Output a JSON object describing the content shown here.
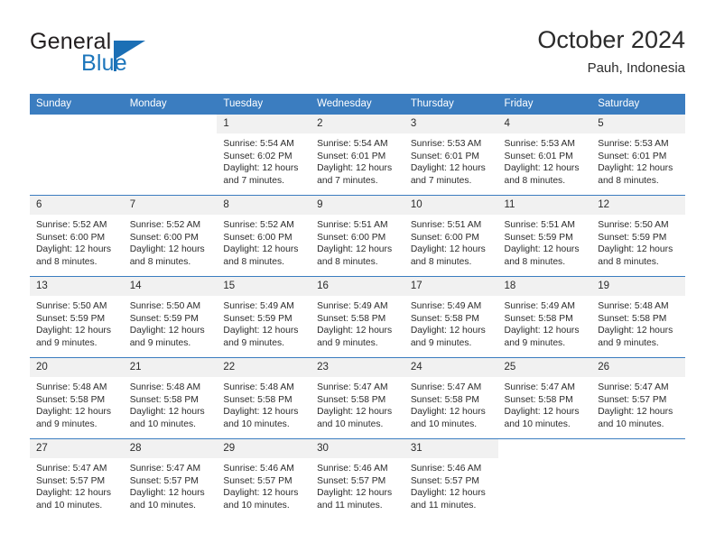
{
  "brand": {
    "word1": "General",
    "word2": "Blue",
    "flag_icon": "triangle-flag-icon"
  },
  "header": {
    "month_title": "October 2024",
    "location": "Pauh, Indonesia"
  },
  "colors": {
    "header_blue": "#3b7dc0",
    "brand_blue": "#1b75bb",
    "daynum_bg": "#f1f1f1",
    "text": "#2b2b2b"
  },
  "calendar": {
    "weekday_headers": [
      "Sunday",
      "Monday",
      "Tuesday",
      "Wednesday",
      "Thursday",
      "Friday",
      "Saturday"
    ],
    "weeks": [
      [
        {
          "empty": true
        },
        {
          "empty": true
        },
        {
          "day": "1",
          "sunrise": "Sunrise: 5:54 AM",
          "sunset": "Sunset: 6:02 PM",
          "daylight1": "Daylight: 12 hours",
          "daylight2": "and 7 minutes."
        },
        {
          "day": "2",
          "sunrise": "Sunrise: 5:54 AM",
          "sunset": "Sunset: 6:01 PM",
          "daylight1": "Daylight: 12 hours",
          "daylight2": "and 7 minutes."
        },
        {
          "day": "3",
          "sunrise": "Sunrise: 5:53 AM",
          "sunset": "Sunset: 6:01 PM",
          "daylight1": "Daylight: 12 hours",
          "daylight2": "and 7 minutes."
        },
        {
          "day": "4",
          "sunrise": "Sunrise: 5:53 AM",
          "sunset": "Sunset: 6:01 PM",
          "daylight1": "Daylight: 12 hours",
          "daylight2": "and 8 minutes."
        },
        {
          "day": "5",
          "sunrise": "Sunrise: 5:53 AM",
          "sunset": "Sunset: 6:01 PM",
          "daylight1": "Daylight: 12 hours",
          "daylight2": "and 8 minutes."
        }
      ],
      [
        {
          "day": "6",
          "sunrise": "Sunrise: 5:52 AM",
          "sunset": "Sunset: 6:00 PM",
          "daylight1": "Daylight: 12 hours",
          "daylight2": "and 8 minutes."
        },
        {
          "day": "7",
          "sunrise": "Sunrise: 5:52 AM",
          "sunset": "Sunset: 6:00 PM",
          "daylight1": "Daylight: 12 hours",
          "daylight2": "and 8 minutes."
        },
        {
          "day": "8",
          "sunrise": "Sunrise: 5:52 AM",
          "sunset": "Sunset: 6:00 PM",
          "daylight1": "Daylight: 12 hours",
          "daylight2": "and 8 minutes."
        },
        {
          "day": "9",
          "sunrise": "Sunrise: 5:51 AM",
          "sunset": "Sunset: 6:00 PM",
          "daylight1": "Daylight: 12 hours",
          "daylight2": "and 8 minutes."
        },
        {
          "day": "10",
          "sunrise": "Sunrise: 5:51 AM",
          "sunset": "Sunset: 6:00 PM",
          "daylight1": "Daylight: 12 hours",
          "daylight2": "and 8 minutes."
        },
        {
          "day": "11",
          "sunrise": "Sunrise: 5:51 AM",
          "sunset": "Sunset: 5:59 PM",
          "daylight1": "Daylight: 12 hours",
          "daylight2": "and 8 minutes."
        },
        {
          "day": "12",
          "sunrise": "Sunrise: 5:50 AM",
          "sunset": "Sunset: 5:59 PM",
          "daylight1": "Daylight: 12 hours",
          "daylight2": "and 8 minutes."
        }
      ],
      [
        {
          "day": "13",
          "sunrise": "Sunrise: 5:50 AM",
          "sunset": "Sunset: 5:59 PM",
          "daylight1": "Daylight: 12 hours",
          "daylight2": "and 9 minutes."
        },
        {
          "day": "14",
          "sunrise": "Sunrise: 5:50 AM",
          "sunset": "Sunset: 5:59 PM",
          "daylight1": "Daylight: 12 hours",
          "daylight2": "and 9 minutes."
        },
        {
          "day": "15",
          "sunrise": "Sunrise: 5:49 AM",
          "sunset": "Sunset: 5:59 PM",
          "daylight1": "Daylight: 12 hours",
          "daylight2": "and 9 minutes."
        },
        {
          "day": "16",
          "sunrise": "Sunrise: 5:49 AM",
          "sunset": "Sunset: 5:58 PM",
          "daylight1": "Daylight: 12 hours",
          "daylight2": "and 9 minutes."
        },
        {
          "day": "17",
          "sunrise": "Sunrise: 5:49 AM",
          "sunset": "Sunset: 5:58 PM",
          "daylight1": "Daylight: 12 hours",
          "daylight2": "and 9 minutes."
        },
        {
          "day": "18",
          "sunrise": "Sunrise: 5:49 AM",
          "sunset": "Sunset: 5:58 PM",
          "daylight1": "Daylight: 12 hours",
          "daylight2": "and 9 minutes."
        },
        {
          "day": "19",
          "sunrise": "Sunrise: 5:48 AM",
          "sunset": "Sunset: 5:58 PM",
          "daylight1": "Daylight: 12 hours",
          "daylight2": "and 9 minutes."
        }
      ],
      [
        {
          "day": "20",
          "sunrise": "Sunrise: 5:48 AM",
          "sunset": "Sunset: 5:58 PM",
          "daylight1": "Daylight: 12 hours",
          "daylight2": "and 9 minutes."
        },
        {
          "day": "21",
          "sunrise": "Sunrise: 5:48 AM",
          "sunset": "Sunset: 5:58 PM",
          "daylight1": "Daylight: 12 hours",
          "daylight2": "and 10 minutes."
        },
        {
          "day": "22",
          "sunrise": "Sunrise: 5:48 AM",
          "sunset": "Sunset: 5:58 PM",
          "daylight1": "Daylight: 12 hours",
          "daylight2": "and 10 minutes."
        },
        {
          "day": "23",
          "sunrise": "Sunrise: 5:47 AM",
          "sunset": "Sunset: 5:58 PM",
          "daylight1": "Daylight: 12 hours",
          "daylight2": "and 10 minutes."
        },
        {
          "day": "24",
          "sunrise": "Sunrise: 5:47 AM",
          "sunset": "Sunset: 5:58 PM",
          "daylight1": "Daylight: 12 hours",
          "daylight2": "and 10 minutes."
        },
        {
          "day": "25",
          "sunrise": "Sunrise: 5:47 AM",
          "sunset": "Sunset: 5:58 PM",
          "daylight1": "Daylight: 12 hours",
          "daylight2": "and 10 minutes."
        },
        {
          "day": "26",
          "sunrise": "Sunrise: 5:47 AM",
          "sunset": "Sunset: 5:57 PM",
          "daylight1": "Daylight: 12 hours",
          "daylight2": "and 10 minutes."
        }
      ],
      [
        {
          "day": "27",
          "sunrise": "Sunrise: 5:47 AM",
          "sunset": "Sunset: 5:57 PM",
          "daylight1": "Daylight: 12 hours",
          "daylight2": "and 10 minutes."
        },
        {
          "day": "28",
          "sunrise": "Sunrise: 5:47 AM",
          "sunset": "Sunset: 5:57 PM",
          "daylight1": "Daylight: 12 hours",
          "daylight2": "and 10 minutes."
        },
        {
          "day": "29",
          "sunrise": "Sunrise: 5:46 AM",
          "sunset": "Sunset: 5:57 PM",
          "daylight1": "Daylight: 12 hours",
          "daylight2": "and 10 minutes."
        },
        {
          "day": "30",
          "sunrise": "Sunrise: 5:46 AM",
          "sunset": "Sunset: 5:57 PM",
          "daylight1": "Daylight: 12 hours",
          "daylight2": "and 11 minutes."
        },
        {
          "day": "31",
          "sunrise": "Sunrise: 5:46 AM",
          "sunset": "Sunset: 5:57 PM",
          "daylight1": "Daylight: 12 hours",
          "daylight2": "and 11 minutes."
        },
        {
          "blank": true
        },
        {
          "blank": true
        }
      ]
    ]
  }
}
